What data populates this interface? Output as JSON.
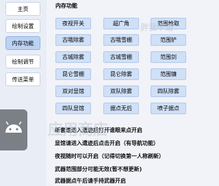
{
  "sidebar": {
    "items": [
      {
        "label": "主页"
      },
      {
        "label": "绘制设置"
      },
      {
        "label": "内存功能"
      },
      {
        "label": "绘制调节"
      },
      {
        "label": "传送菜单"
      }
    ]
  },
  "main": {
    "section_title": "内存功能",
    "buttons": [
      [
        "夜视开关",
        "超广角",
        "范围枪取"
      ],
      [
        "古哦除雾",
        "古哦雪棚",
        "范围铲"
      ],
      [
        "古城除雾",
        "古城雪棚",
        "范围剑"
      ],
      [
        "昆仑雪棚",
        "昆仑除雾",
        "范围镰"
      ],
      [
        "双对显馆",
        "双队除雾",
        "四队除雾"
      ],
      [
        "四队显馆",
        "据点无后",
        "喷子据点"
      ]
    ],
    "notes": [
      "新套速进入遗迹后打开谁眼来点开启",
      "显馆请进入遗迹后点击开启（有导航功能）",
      "夜视随时可以开启（记得切换第一人称刷新）",
      "武器范围部分可能无效(暂不想更新)",
      "武器据点午后请手持武器开启"
    ]
  },
  "watermarks": [
    "胖我卡通",
    "应用商店"
  ],
  "colors": {
    "active_tab": "#bcd2f3",
    "button_fill": "#cfe0f7"
  }
}
